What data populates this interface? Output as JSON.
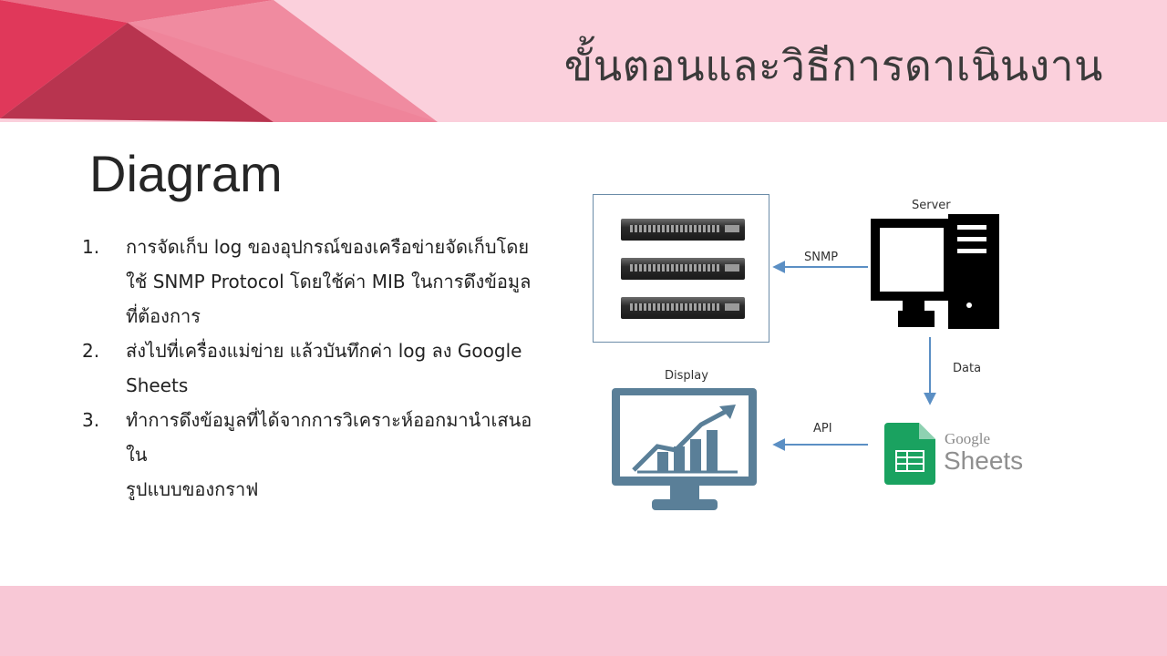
{
  "header": {
    "title": "ขั้นตอนและวิธีการดาเนินงาน"
  },
  "section": {
    "heading": "Diagram"
  },
  "steps": [
    {
      "num": "1.",
      "lines": [
        "การจัดเก็บ log ของอุปกรณ์ของเครือข่ายจัดเก็บโดย",
        "ใช้ SNMP Protocol โดยใช้ค่า MIB ในการดึงข้อมูล",
        "ที่ต้องการ"
      ]
    },
    {
      "num": "2.",
      "lines": [
        "ส่งไปที่เครื่องแม่ข่าย แล้วบันทึกค่า log ลง Google",
        "Sheets"
      ]
    },
    {
      "num": "3.",
      "lines": [
        "ทำการดึงข้อมูลที่ได้จากการวิเคราะห์ออกมานำเสนอใน",
        "รูปแบบของกราฟ"
      ]
    }
  ],
  "diagram": {
    "server_label": "Server",
    "snmp_label": "SNMP",
    "data_label": "Data",
    "api_label": "API",
    "display_label": "Display",
    "google_label": "Google",
    "sheets_label": "Sheets",
    "colors": {
      "arrow": "#5b8fc4",
      "monitor": "#5a7f98",
      "sheets_green": "#1aa260",
      "pink_band": "#fbd0dc"
    }
  },
  "icons": [
    "network-switch-icon",
    "server-computer-icon",
    "monitor-chart-icon",
    "google-sheets-icon"
  ]
}
